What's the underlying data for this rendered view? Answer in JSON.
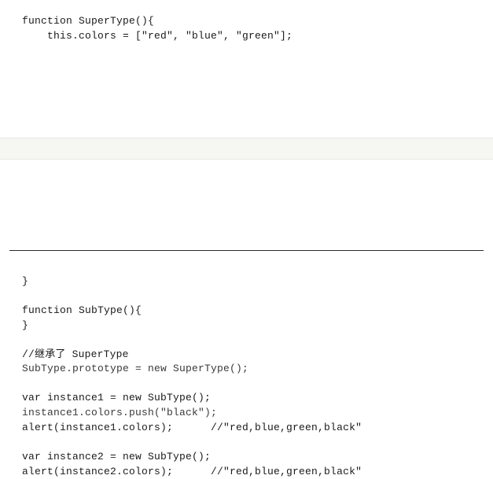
{
  "code_top": {
    "line1": "function SuperType(){",
    "line2": "    this.colors = [\"red\", \"blue\", \"green\"];"
  },
  "code_bottom": {
    "line1": "}",
    "line2": "function SubType(){",
    "line3": "}",
    "line4": "//继承了 SuperType",
    "line5": "SubType.prototype = new SuperType();",
    "line6": "var instance1 = new SubType();",
    "line7": "instance1.colors.push(\"black\");",
    "line8": "alert(instance1.colors);      //\"red,blue,green,black\"",
    "line9": "var instance2 = new SubType();",
    "line10": "alert(instance2.colors);      //\"red,blue,green,black\""
  }
}
